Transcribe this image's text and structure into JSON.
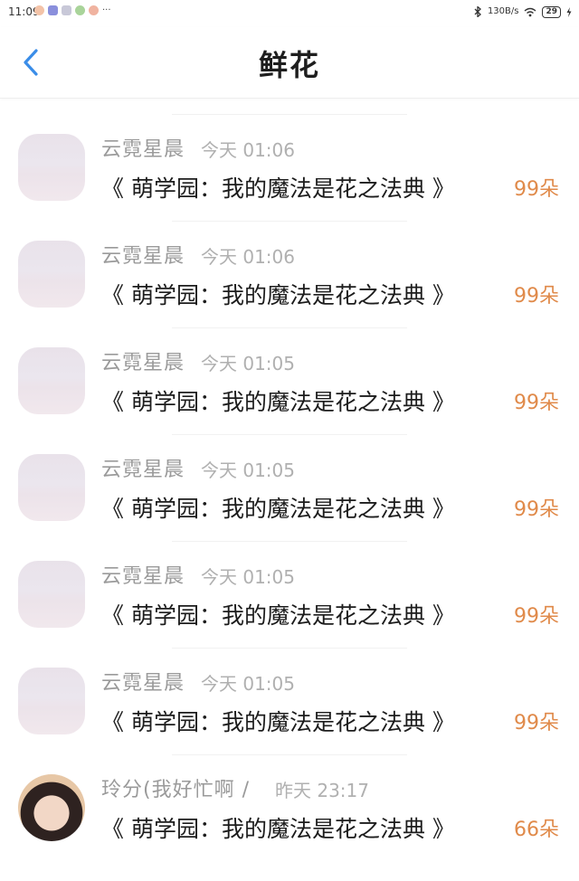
{
  "status_bar": {
    "time": "11:09",
    "network_speed": "130B/s",
    "battery": "29",
    "notification_icons": [
      "weibo-icon",
      "app-icon",
      "message-icon",
      "wechat-icon",
      "weibo-icon"
    ],
    "more": "···"
  },
  "header": {
    "title": "鲜花",
    "back_icon": "chevron-left-icon"
  },
  "colors": {
    "accent_blue": "#3a8de8",
    "amount_orange": "#e08a4a",
    "name_gray": "#9a9a9a"
  },
  "records": [
    {
      "user": "云霓星晨",
      "time": "今天 01:06",
      "title": "《 萌学园：我的魔法是花之法典 》",
      "amount": "99朵",
      "avatar": "sky"
    },
    {
      "user": "云霓星晨",
      "time": "今天 01:06",
      "title": "《 萌学园：我的魔法是花之法典 》",
      "amount": "99朵",
      "avatar": "sky"
    },
    {
      "user": "云霓星晨",
      "time": "今天 01:05",
      "title": "《 萌学园：我的魔法是花之法典 》",
      "amount": "99朵",
      "avatar": "sky"
    },
    {
      "user": "云霓星晨",
      "time": "今天 01:05",
      "title": "《 萌学园：我的魔法是花之法典 》",
      "amount": "99朵",
      "avatar": "sky"
    },
    {
      "user": "云霓星晨",
      "time": "今天 01:05",
      "title": "《 萌学园：我的魔法是花之法典 》",
      "amount": "99朵",
      "avatar": "sky"
    },
    {
      "user": "云霓星晨",
      "time": "今天 01:05",
      "title": "《 萌学园：我的魔法是花之法典 》",
      "amount": "99朵",
      "avatar": "sky"
    },
    {
      "user": "玲分(我好忙啊 /",
      "time": "昨天 23:17",
      "title": "《 萌学园：我的魔法是花之法典 》",
      "amount": "66朵",
      "avatar": "girl"
    }
  ]
}
